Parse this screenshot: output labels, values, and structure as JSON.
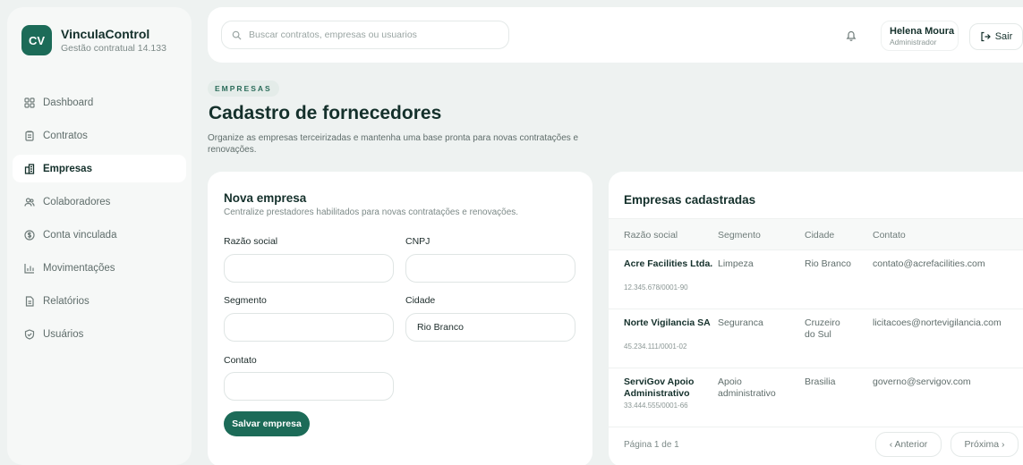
{
  "brand": {
    "logo": "CV",
    "name": "VinculaControl",
    "subtitle": "Gestão contratual 14.133"
  },
  "sidebar": {
    "items": [
      {
        "label": "Dashboard",
        "icon": "dashboard-icon"
      },
      {
        "label": "Contratos",
        "icon": "contracts-icon"
      },
      {
        "label": "Empresas",
        "icon": "companies-icon",
        "active": true
      },
      {
        "label": "Colaboradores",
        "icon": "users-icon"
      },
      {
        "label": "Conta vinculada",
        "icon": "account-icon"
      },
      {
        "label": "Movimentações",
        "icon": "chart-icon"
      },
      {
        "label": "Relatórios",
        "icon": "report-icon"
      },
      {
        "label": "Usuários",
        "icon": "shield-icon"
      }
    ]
  },
  "topbar": {
    "search_placeholder": "Buscar contratos, empresas ou usuarios",
    "user_name": "Helena Moura",
    "user_role": "Administrador",
    "logout_label": "Sair"
  },
  "page": {
    "badge": "EMPRESAS",
    "title": "Cadastro de fornecedores",
    "description": "Organize as empresas terceirizadas e mantenha uma base pronta para novas contratações e renovações."
  },
  "form": {
    "title": "Nova empresa",
    "subtitle": "Centralize prestadores habilitados para novas contratações e renovações.",
    "labels": {
      "razao": "Razão social",
      "cnpj": "CNPJ",
      "segmento": "Segmento",
      "cidade": "Cidade",
      "contato": "Contato"
    },
    "values": {
      "razao": "",
      "cnpj": "",
      "segmento": "",
      "cidade": "Rio Branco",
      "contato": ""
    },
    "save_label": "Salvar empresa"
  },
  "table": {
    "title": "Empresas cadastradas",
    "columns": [
      "Razão social",
      "Segmento",
      "Cidade",
      "Contato"
    ],
    "rows": [
      {
        "name": "Acre Facilities Ltda.",
        "cnpj": "12.345.678/0001-90",
        "segmento": "Limpeza",
        "cidade": "Rio Branco",
        "contato": "contato@acrefacilities.com"
      },
      {
        "name": "Norte Vigilancia SA",
        "cnpj": "45.234.111/0001-02",
        "segmento": "Seguranca",
        "cidade": "Cruzeiro do Sul",
        "contato": "licitacoes@nortevigilancia.com"
      },
      {
        "name": "ServiGov Apoio Administrativo",
        "cnpj": "33.444.555/0001-66",
        "segmento": "Apoio administrativo",
        "cidade": "Brasilia",
        "contato": "governo@servigov.com"
      }
    ],
    "pagination": {
      "text": "Página 1 de 1",
      "prev": "‹ Anterior",
      "next": "Próxima ›"
    }
  },
  "colors": {
    "brand": "#1c6b58",
    "background": "#eef2f1",
    "card": "#ffffff",
    "muted": "#7d8a88"
  }
}
